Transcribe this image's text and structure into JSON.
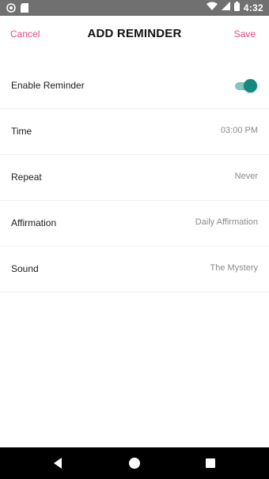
{
  "status_bar": {
    "time": "4:32",
    "icons": [
      "sync-icon",
      "sd-card-icon",
      "wifi-icon",
      "signal-icon",
      "battery-icon"
    ]
  },
  "header": {
    "cancel_label": "Cancel",
    "title": "ADD REMINDER",
    "save_label": "Save"
  },
  "settings": {
    "enable_reminder": {
      "label": "Enable Reminder",
      "enabled": true
    },
    "time": {
      "label": "Time",
      "value": "03:00 PM"
    },
    "repeat": {
      "label": "Repeat",
      "value": "Never"
    },
    "affirmation": {
      "label": "Affirmation",
      "value": "Daily Affirmation"
    },
    "sound": {
      "label": "Sound",
      "value": "The Mystery"
    }
  },
  "colors": {
    "accent": "#e8457e",
    "toggle_on": "#128a7f",
    "toggle_track": "#7fc8bf",
    "status_bar": "#707070"
  },
  "nav_bar": {
    "icons": [
      "back-icon",
      "home-icon",
      "recents-icon"
    ]
  }
}
